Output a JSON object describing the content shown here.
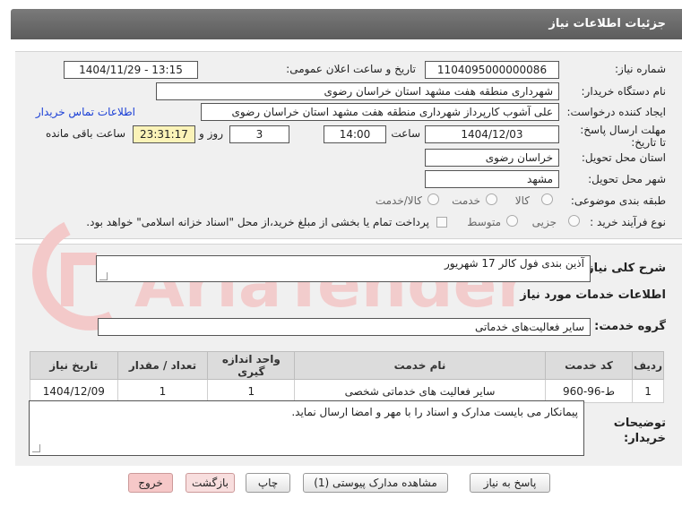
{
  "header": {
    "title": "جزئیات اطلاعات نیاز"
  },
  "form": {
    "need_number_label": "شماره نیاز:",
    "need_number": "1104095000000086",
    "announce_label": "تاریخ و ساعت اعلان عمومی:",
    "announce_value": "1404/11/29 - 13:15",
    "buyer_org_label": "نام دستگاه خریدار:",
    "buyer_org": "شهرداری منطقه هفت مشهد استان خراسان رضوی",
    "creator_label": "ایجاد کننده درخواست:",
    "creator": "علی آشوب کارپرداز شهرداری منطقه هفت مشهد استان خراسان رضوی",
    "contact_link": "اطلاعات تماس خریدار",
    "deadline_label": "مهلت ارسال پاسخ: تا تاریخ:",
    "deadline_date": "1404/12/03",
    "time_label": "ساعت",
    "deadline_time": "14:00",
    "days_value": "3",
    "days_label": "روز و",
    "remaining_time": "23:31:17",
    "remaining_label": "ساعت باقی مانده",
    "province_label": "استان محل تحویل:",
    "province": "خراسان رضوی",
    "city_label": "شهر محل تحویل:",
    "city": "مشهد",
    "category_label": "طبقه بندی موضوعی:",
    "category_options": [
      "کالا",
      "خدمت",
      "کالا/خدمت"
    ],
    "process_label": "نوع فرآیند خرید :",
    "process_options": [
      "جزیی",
      "متوسط"
    ],
    "payment_note": "پرداخت تمام یا بخشی از مبلغ خرید،از محل \"اسناد خزانه اسلامی\" خواهد بود."
  },
  "description": {
    "label": "شرح کلی نیاز:",
    "value": "آذین بندی فول کالر 17 شهریور"
  },
  "services": {
    "section_title": "اطلاعات خدمات مورد نیاز",
    "group_label": "گروه خدمت:",
    "group_value": "سایر فعالیت‌های خدماتی",
    "columns": [
      "ردیف",
      "کد خدمت",
      "نام خدمت",
      "واحد اندازه گیری",
      "تعداد / مقدار",
      "تاریخ نیاز"
    ],
    "rows": [
      {
        "row": "1",
        "code": "ط-96-960",
        "name": "سایر فعالیت های خدماتی شخصی",
        "unit": "1",
        "qty": "1",
        "date": "1404/12/09"
      }
    ]
  },
  "notes": {
    "label": "توضیحات خریدار:",
    "value": "پیمانکار می بایست مدارک و اسناد را با مهر و امضا ارسال نماید."
  },
  "buttons": {
    "reply": "پاسخ به نیاز",
    "attachments": "مشاهده مدارک پیوستی (1)",
    "print": "چاپ",
    "back": "بازگشت",
    "exit": "خروج"
  },
  "watermark": {
    "text": "AriaTender.net"
  },
  "colors": {
    "titlebar": "#666666",
    "panel": "#f0f0f0",
    "link": "#1a3fd6",
    "remaining_bg": "#fbf3b8",
    "exit_bg": "#f6c8c8",
    "watermark": "#f3c9c9"
  }
}
